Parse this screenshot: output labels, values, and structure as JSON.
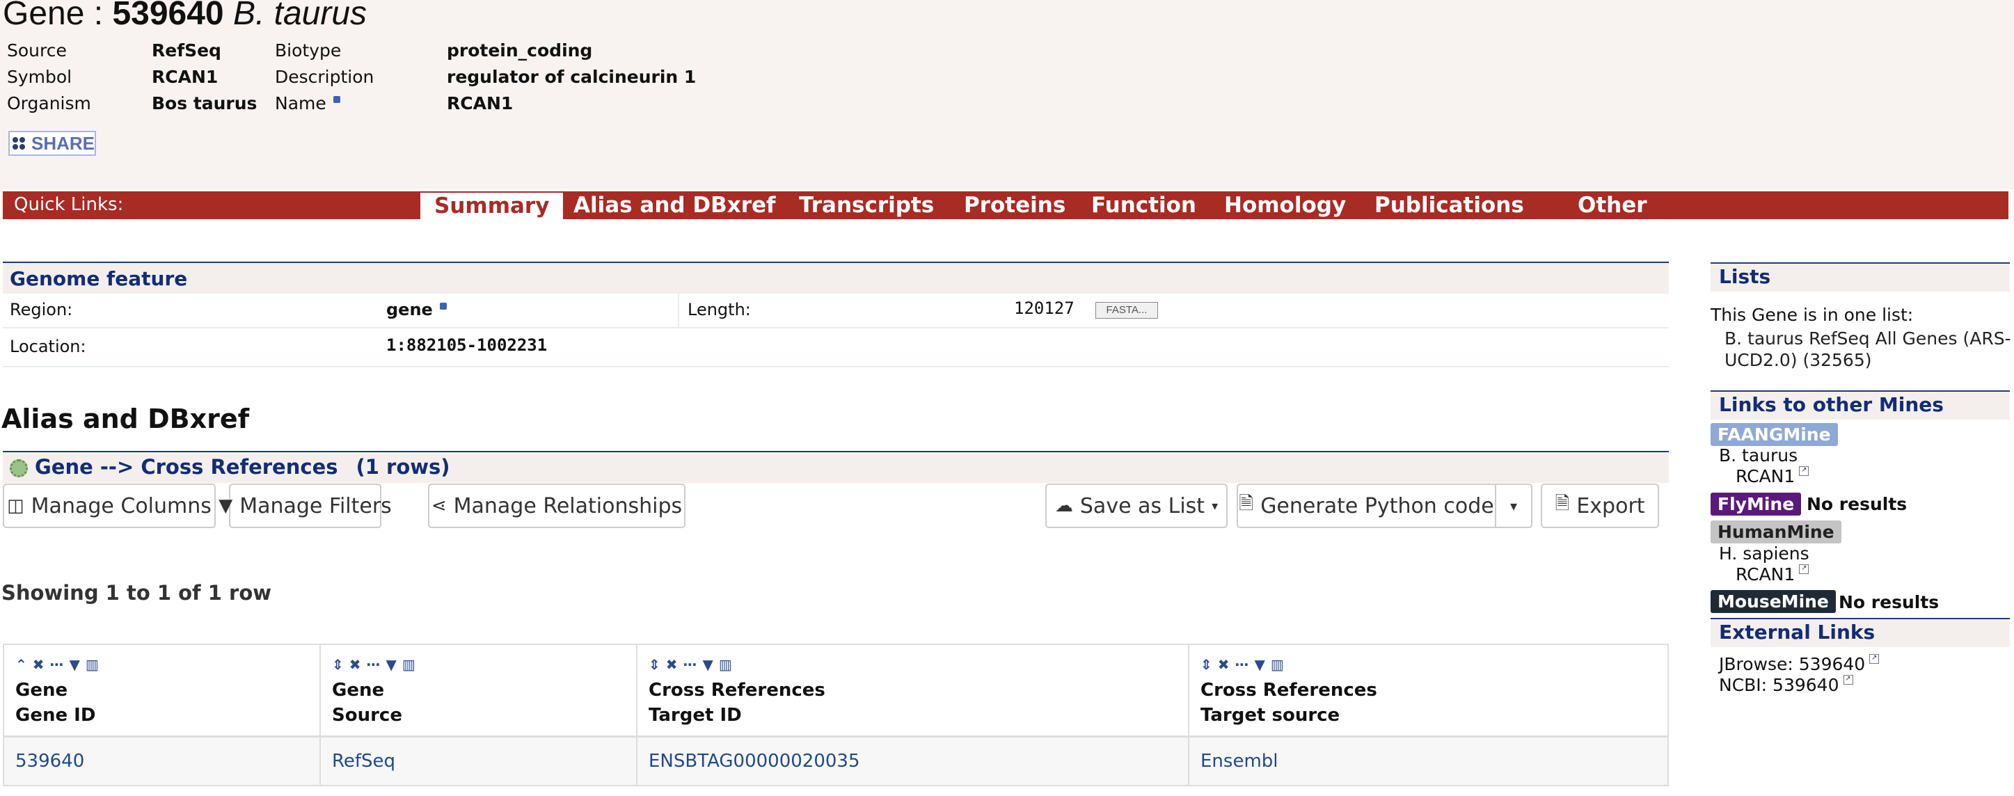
{
  "header": {
    "title_prefix": "Gene : ",
    "gene_id": "539640",
    "organism_short": "B. taurus",
    "summary": {
      "source_label": "Source",
      "source_value": "RefSeq",
      "symbol_label": "Symbol",
      "symbol_value": "RCAN1",
      "organism_label": "Organism",
      "organism_value": "Bos taurus",
      "biotype_label": "Biotype",
      "biotype_value": "protein_coding",
      "description_label": "Description",
      "description_value": "regulator of calcineurin 1",
      "name_label": "Name",
      "name_value": "RCAN1"
    },
    "share_label": "SHARE"
  },
  "quick_links": {
    "label": "Quick Links:",
    "tabs": [
      "Summary",
      "Alias and DBxref",
      "Transcripts",
      "Proteins",
      "Function",
      "Homology",
      "Publications",
      "Other"
    ]
  },
  "genome_feature": {
    "title": "Genome feature",
    "region_label": "Region:",
    "region_value": "gene",
    "length_label": "Length:",
    "length_value": "120127",
    "fasta_label": "FASTA...",
    "location_label": "Location:",
    "location_value": "1:882105-1002231"
  },
  "alias": {
    "heading": "Alias and DBxref",
    "table_title": "Gene --> Cross References",
    "row_count": "(1 rows)",
    "buttons": {
      "manage_columns": "Manage Columns",
      "manage_filters": "Manage Filters",
      "manage_relationships": "Manage Relationships",
      "save_as_list": "Save as List",
      "generate_python": "Generate Python code",
      "export": "Export"
    },
    "showing": "Showing 1 to 1 of 1 row",
    "columns": [
      {
        "line1": "Gene",
        "line2": "Gene ID"
      },
      {
        "line1": "Gene",
        "line2": "Source"
      },
      {
        "line1": "Cross References",
        "line2": "Target ID"
      },
      {
        "line1": "Cross References",
        "line2": "Target source"
      }
    ],
    "rows": [
      [
        "539640",
        "RefSeq",
        "ENSBTAG00000020035",
        "Ensembl"
      ]
    ]
  },
  "sidebar": {
    "lists_title": "Lists",
    "lists_text": "This Gene is in one list:",
    "list_item_line1": "B. taurus RefSeq All Genes (ARS-",
    "list_item_line2": "UCD2.0) (32565)",
    "other_mines_title": "Links to other Mines",
    "mines": [
      {
        "name": "FAANGMine",
        "bg": "#8fa8d6",
        "fg": "#ffffff",
        "organism": "B. taurus",
        "gene": "RCAN1",
        "result": ""
      },
      {
        "name": "FlyMine",
        "bg": "#5b1a7a",
        "fg": "#ffffff",
        "organism": "",
        "gene": "",
        "result": "No results"
      },
      {
        "name": "HumanMine",
        "bg": "#c4c4c4",
        "fg": "#222222",
        "organism": "H. sapiens",
        "gene": "RCAN1",
        "result": ""
      },
      {
        "name": "MouseMine",
        "bg": "#1f2a35",
        "fg": "#ffffff",
        "organism": "",
        "gene": "",
        "result": "No results"
      }
    ],
    "external_title": "External Links",
    "jbrowse": "JBrowse: 539640",
    "ncbi": "NCBI: 539640"
  },
  "colors": {
    "quicklinks_bar": "#a82b24",
    "section_title": "#122d75",
    "link": "#1f4a8a"
  }
}
